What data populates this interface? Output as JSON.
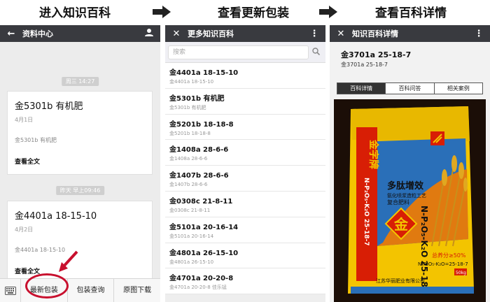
{
  "captions": [
    "进入知识百科",
    "查看更新包装",
    "查看百科详情"
  ],
  "phone1": {
    "title": "资料中心",
    "time1": "周三 14:27",
    "card1": {
      "title": "金5301b 有机肥",
      "date": "4月1日",
      "summary": "金5301b 有机肥",
      "read": "查看全文"
    },
    "time2": "昨天 早上09:46",
    "card2": {
      "title": "金4401a 18-15-10",
      "date": "4月2日",
      "summary": "金4401a 18-15-10",
      "read": "查看全文"
    },
    "menu": [
      "最新包装",
      "包装查询",
      "原图下载"
    ]
  },
  "phone2": {
    "title": "更多知识百科",
    "search_placeholder": "搜索",
    "items": [
      {
        "title": "金4401a 18-15-10",
        "sub": "金4401a 18-15-10"
      },
      {
        "title": "金5301b 有机肥",
        "sub": "金5301b 有机肥"
      },
      {
        "title": "金5201b 18-18-8",
        "sub": "金5201b 18-18-8"
      },
      {
        "title": "金1408a 28-6-6",
        "sub": "金1408a 28-6-6"
      },
      {
        "title": "金1407b 28-6-6",
        "sub": "金1407b 28-6-6"
      },
      {
        "title": "金0308c 21-8-11",
        "sub": "金0308c 21-8-11"
      },
      {
        "title": "金5101a 20-16-14",
        "sub": "金5101a 20-16-14"
      },
      {
        "title": "金4801a 26-15-10",
        "sub": "金4801a 26-15-10"
      },
      {
        "title": "金4701a 20-20-8",
        "sub": "金4701a 20-20-8 佳乐锰"
      }
    ]
  },
  "phone3": {
    "title": "知识百科详情",
    "product_title": "金3701a 25-18-7",
    "product_sub": "金3701a 25-18-7",
    "tabs": [
      "百科详情",
      "百科问答",
      "相关案例"
    ],
    "bag": {
      "brand": "金字牌",
      "slogan": "多肽增效",
      "sub1": "氨化喷浆造粒工艺",
      "sub2": "复合肥料",
      "formula": "N-P₂O₅-K₂O 25-18-7",
      "formula_side": "N-P₂O₅-K₂O 25-18-7",
      "nutrient": "总养分≥50%",
      "formula_small": "N-P₂O₅-K₂O=25-18-7",
      "weight": "50kg",
      "company": "江苏华丽肥业有限公司"
    }
  }
}
